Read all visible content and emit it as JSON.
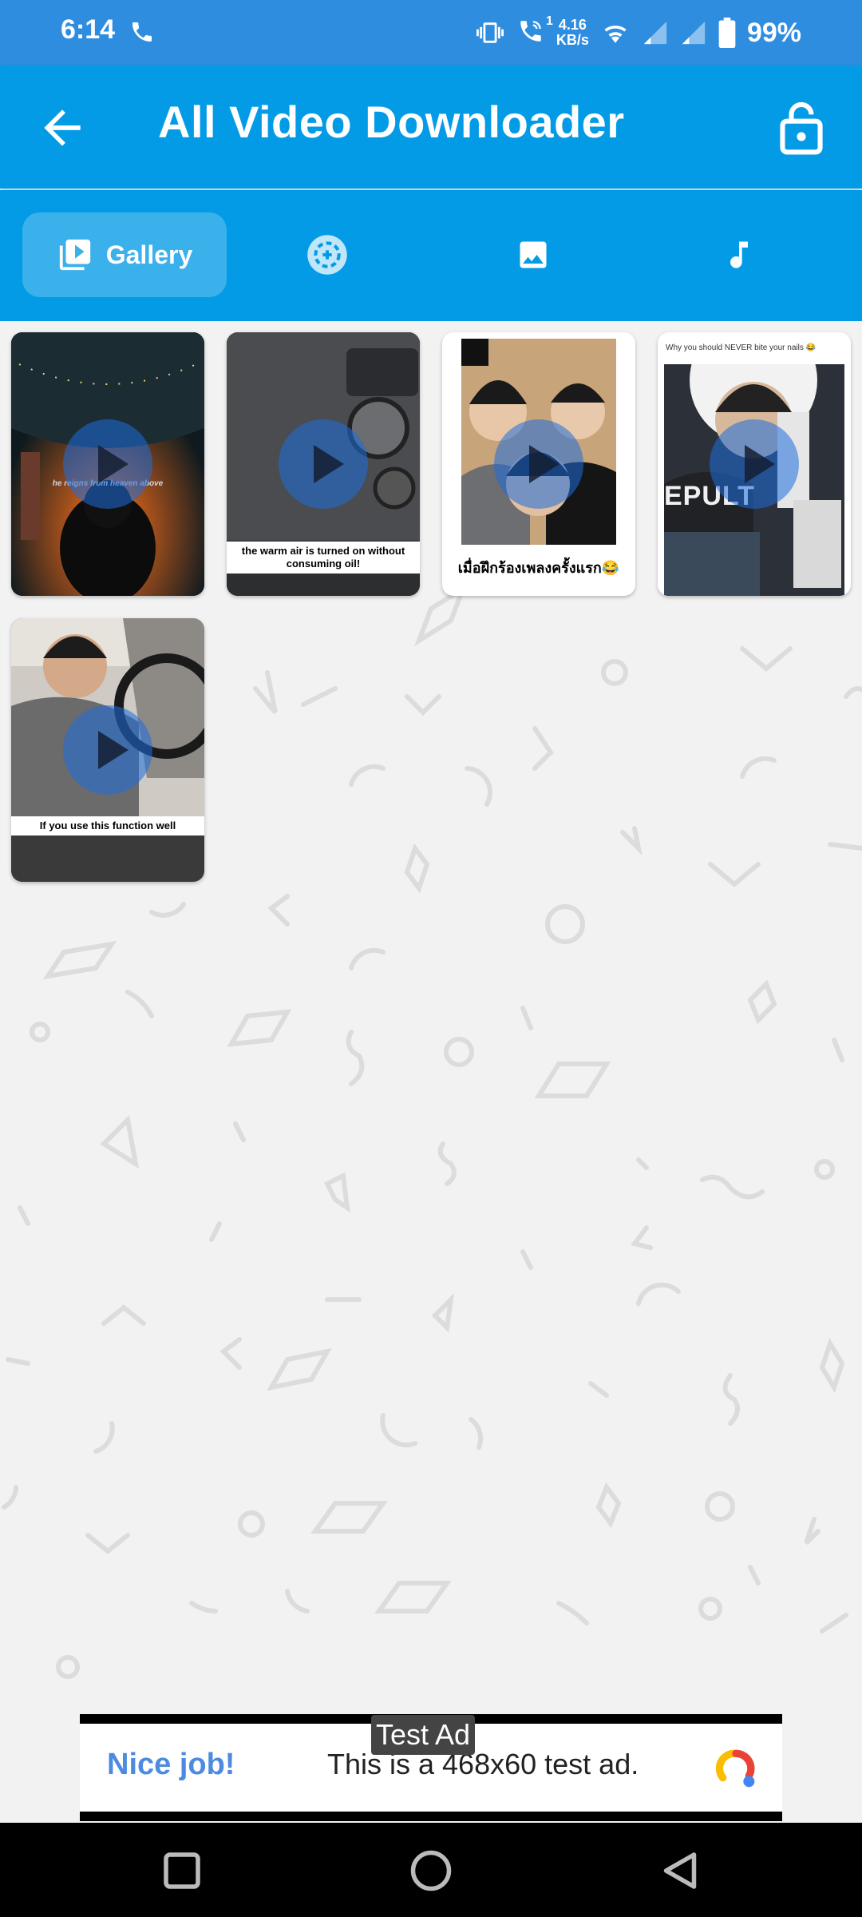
{
  "status_bar": {
    "time": "6:14",
    "net_speed_value": "4.16",
    "net_speed_unit": "KB/s",
    "battery": "99%",
    "call_badge": "1"
  },
  "app_bar": {
    "title": "All Video Downloader"
  },
  "tabs": [
    {
      "label": "Gallery",
      "icon": "video-gallery-icon",
      "selected": true
    },
    {
      "label": "",
      "icon": "status-saver-icon",
      "selected": false
    },
    {
      "label": "",
      "icon": "image-icon",
      "selected": false
    },
    {
      "label": "",
      "icon": "music-note-icon",
      "selected": false
    }
  ],
  "videos": [
    {
      "caption": "he reigns from heaven above"
    },
    {
      "caption": "the warm air is turned on without consuming oil!"
    },
    {
      "caption": "เมื่อฝึกร้องเพลงครั้งแรก😂"
    },
    {
      "caption": "Why you should NEVER bite your nails 😂",
      "overlay": "EPULT"
    },
    {
      "caption": "If you use this function well"
    }
  ],
  "ad": {
    "tag": "Test Ad",
    "title": "Nice job!",
    "text": "This is a 468x60 test ad."
  },
  "colors": {
    "app_bar": "#049be6",
    "status_bar": "#2f8de0",
    "background": "#f2f2f2",
    "ad_title": "#4c8be0"
  }
}
